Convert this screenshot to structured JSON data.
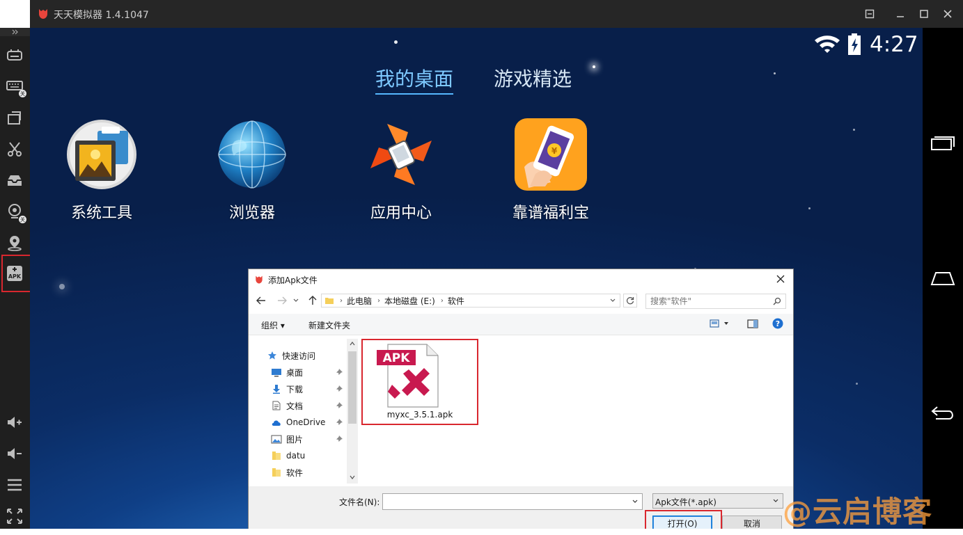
{
  "window": {
    "title": "天天模拟器 1.4.1047"
  },
  "sidebar": {
    "items": [
      {
        "name": "gamepad"
      },
      {
        "name": "keyboard",
        "badge": "关"
      },
      {
        "name": "screen-rotate"
      },
      {
        "name": "screenshot-scissors"
      },
      {
        "name": "shared-folder"
      },
      {
        "name": "camera",
        "badge": "关"
      },
      {
        "name": "location"
      },
      {
        "name": "apk-install",
        "label": "APK"
      },
      {
        "name": "volume-up"
      },
      {
        "name": "volume-down"
      },
      {
        "name": "menu"
      },
      {
        "name": "fullscreen"
      }
    ]
  },
  "statusbar": {
    "time": "4:27"
  },
  "tabs": [
    {
      "label": "我的桌面",
      "active": true
    },
    {
      "label": "游戏精选",
      "active": false
    }
  ],
  "apps": [
    {
      "label": "系统工具"
    },
    {
      "label": "浏览器"
    },
    {
      "label": "应用中心"
    },
    {
      "label": "靠谱福利宝"
    }
  ],
  "dialog": {
    "title": "添加Apk文件",
    "breadcrumb": [
      "此电脑",
      "本地磁盘 (E:)",
      "软件"
    ],
    "search_placeholder": "搜索\"软件\"",
    "toolbar": {
      "organize": "组织 ▾",
      "new_folder": "新建文件夹"
    },
    "nav": [
      {
        "label": "快速访问",
        "icon": "star-icon"
      },
      {
        "label": "桌面",
        "icon": "desktop-icon",
        "pinned": true
      },
      {
        "label": "下载",
        "icon": "download-icon",
        "pinned": true
      },
      {
        "label": "文档",
        "icon": "document-icon",
        "pinned": true
      },
      {
        "label": "OneDrive",
        "icon": "cloud-icon",
        "pinned": true
      },
      {
        "label": "图片",
        "icon": "picture-icon",
        "pinned": true
      },
      {
        "label": "datu",
        "icon": "folder-icon"
      },
      {
        "label": "软件",
        "icon": "folder-icon"
      }
    ],
    "file": {
      "badge": "APK",
      "name": "myxc_3.5.1.apk"
    },
    "filename_label": "文件名(N):",
    "filename_value": "",
    "filetype": "Apk文件(*.apk)",
    "open_button": "打开(O)",
    "cancel_button": "取消"
  },
  "watermark": "@云启博客",
  "colors": {
    "accent_tab": "#7ec9ff",
    "highlight": "#d9272e",
    "watermark": "#ffa03c"
  }
}
